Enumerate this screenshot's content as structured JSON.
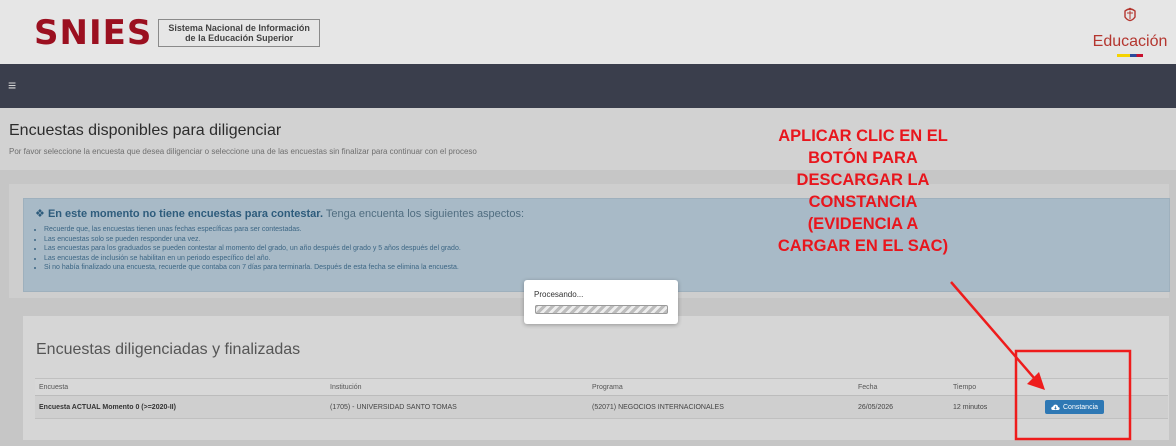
{
  "header": {
    "logo_word": "SNIES",
    "logo_line1": "Sistema Nacional de Información",
    "logo_line2": "de la Educación Superior",
    "ministry_label": "Educación"
  },
  "navbar": {
    "menu_glyph": "≡"
  },
  "page": {
    "title": "Encuestas disponibles para diligenciar",
    "subtitle": "Por favor seleccione la encuesta que desea diligenciar o seleccione una de las encuestas sin finalizar para continuar con el proceso"
  },
  "alert": {
    "heading_strong": "En este momento no tiene encuestas para contestar.",
    "heading_rest": "Tenga encuenta los siguientes aspectos:",
    "items": [
      "Recuerde que, las encuestas tienen unas fechas específicas para ser contestadas.",
      "Las encuestas solo se pueden responder una vez.",
      "Las encuestas para los graduados se pueden contestar al momento del grado, un año después del grado y 5 años después del grado.",
      "Las encuestas de inclusión se habilitan en un periodo específico del año.",
      "Si no había finalizado una encuesta, recuerde que contaba con 7 días para terminarla. Después de esta fecha se elimina la encuesta."
    ]
  },
  "modal": {
    "text": "Procesando..."
  },
  "finished": {
    "title": "Encuestas diligenciadas y finalizadas",
    "columns": [
      "Encuesta",
      "Institución",
      "Programa",
      "Fecha",
      "Tiempo"
    ],
    "rows": [
      {
        "encuesta": "Encuesta ACTUAL Momento 0 (>=2020-II)",
        "institucion": "(1705) - UNIVERSIDAD SANTO TOMAS",
        "programa": "(52071) NEGOCIOS INTERNACIONALES",
        "fecha": "26/05/2026",
        "tiempo": "12 minutos",
        "action_label": "Constancia"
      }
    ]
  },
  "annotation": {
    "text": "APLICAR CLIC EN EL\nBOTÓN PARA\nDESCARGAR LA\nCONSTANCIA\n(EVIDENCIA A\nCARGAR EN EL SAC)",
    "color": "#e8161d"
  }
}
